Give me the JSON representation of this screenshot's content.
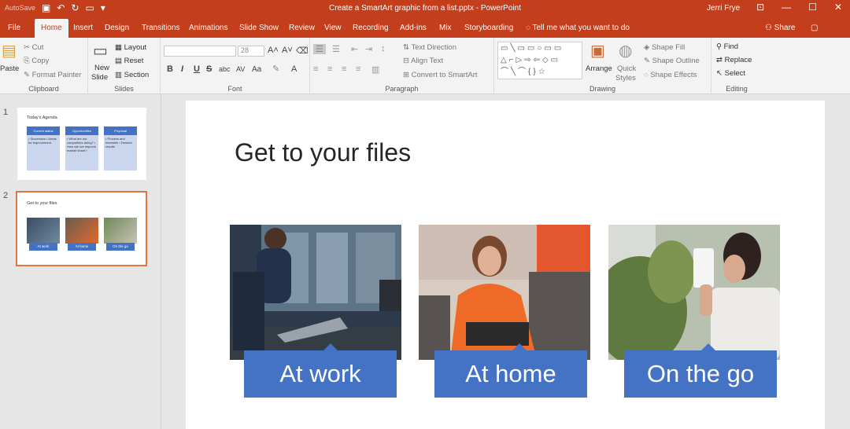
{
  "titlebar": {
    "autosave": "AutoSave",
    "doc_title": "Create a SmartArt graphic from a list.pptx  -  PowerPoint",
    "user": "Jerri Frye"
  },
  "tabs": [
    "File",
    "Home",
    "Insert",
    "Design",
    "Transitions",
    "Animations",
    "Slide Show",
    "Review",
    "View",
    "Recording",
    "Add-ins",
    "Mix",
    "Storyboarding"
  ],
  "tell_me": "Tell me what you want to do",
  "share": "Share",
  "ribbon": {
    "clipboard": {
      "paste": "Paste",
      "cut": "Cut",
      "copy": "Copy",
      "format_painter": "Format Painter",
      "label": "Clipboard"
    },
    "slides": {
      "new_slide": "New",
      "new_slide2": "Slide",
      "layout": "Layout",
      "reset": "Reset",
      "section": "Section",
      "label": "Slides"
    },
    "font": {
      "size": "28",
      "label": "Font",
      "bold": "B",
      "italic": "I",
      "underline": "U",
      "strike": "S",
      "shadow": "abc",
      "spacing": "AV",
      "case": "Aa",
      "clear": "A"
    },
    "paragraph": {
      "text_direction": "Text Direction",
      "align_text": "Align Text",
      "convert": "Convert to SmartArt",
      "label": "Paragraph"
    },
    "drawing": {
      "arrange": "Arrange",
      "quick_styles": "Quick",
      "quick_styles2": "Styles",
      "shape_fill": "Shape Fill",
      "shape_outline": "Shape Outline",
      "shape_effects": "Shape Effects",
      "label": "Drawing"
    },
    "editing": {
      "find": "Find",
      "replace": "Replace",
      "select": "Select",
      "label": "Editing"
    }
  },
  "slides": [
    {
      "number": "1",
      "title": "Today's Agenda",
      "columns": [
        {
          "head": "Current status",
          "text": "• Successes • Areas for improvement"
        },
        {
          "head": "Opportunities",
          "text": "• What are our competitors doing? • How can we improve market share?"
        },
        {
          "head": "Proposal",
          "text": "• Process and timetable • Desired results"
        }
      ]
    },
    {
      "number": "2",
      "title": "Get to your files",
      "labels": [
        "At work",
        "At home",
        "On the go"
      ]
    }
  ],
  "current_slide": {
    "title": "Get to your files",
    "items": [
      {
        "caption": "At work",
        "photo": "man-at-desk-photo"
      },
      {
        "caption": "At home",
        "photo": "woman-on-couch-photo"
      },
      {
        "caption": "On the go",
        "photo": "woman-with-phone-photo"
      }
    ]
  },
  "colors": {
    "accent": "#c43e1c",
    "smartart_blue": "#4472c4",
    "selection": "#e07540"
  }
}
